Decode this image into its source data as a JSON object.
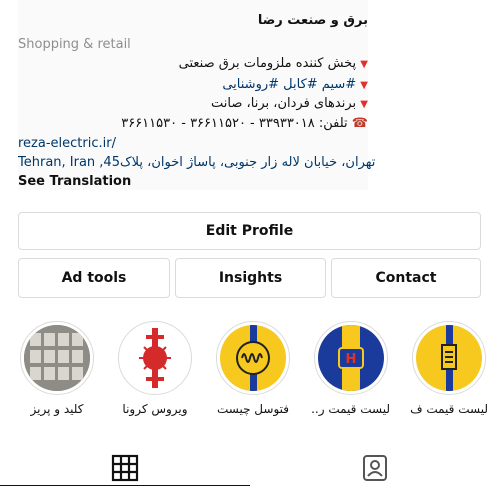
{
  "profile": {
    "name": "برق و صنعت رضا",
    "category": "Shopping & retail",
    "bio_lines": [
      "پخش کننده ملزومات برق صنعتی",
      "#سیم #کابل #روشنایی",
      "برندهای فردان، برنا، صانت",
      "تلفن: ۳۳۹۳۳۰۱۸ - ۳۶۶۱۱۵۲۰ - ۳۶۶۱۱۵۳۰"
    ],
    "link": "reza-electric.ir/",
    "address": "Tehran, Iran ,45تهران، خیابان لاله زار جنوبی، پاساژ اخوان، پلاک",
    "see_translation": "See Translation"
  },
  "buttons": {
    "edit_profile": "Edit Profile",
    "ad_tools": "Ad tools",
    "insights": "Insights",
    "contact": "Contact"
  },
  "highlights": [
    {
      "label": "کلید و پریز"
    },
    {
      "label": "ویروس کرونا"
    },
    {
      "label": "فتوسل چیست"
    },
    {
      "label": "لیست قیمت ر..."
    },
    {
      "label": "لیست قیمت ف..."
    }
  ],
  "colors": {
    "accent_blue": "#00376b",
    "brand_yellow": "#f7c81e",
    "brand_blue": "#1a3b9c",
    "bullet_red": "#e0312b"
  },
  "icons": {
    "grid_tab": "grid-icon",
    "tagged_tab": "tagged-icon"
  }
}
